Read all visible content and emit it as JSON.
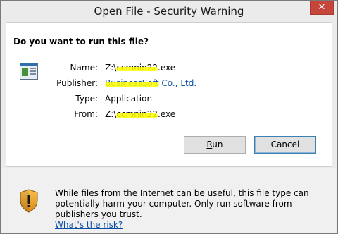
{
  "window": {
    "title": "Open File - Security Warning",
    "close_glyph": "✕"
  },
  "question": "Do you want to run this file?",
  "file_icon": "application-window-icon",
  "details": {
    "name_label": "Name:",
    "name_value_prefix": "Z:\\",
    "name_value_hidden": "ccmnin22",
    "name_value_suffix": ".exe",
    "publisher_label": "Publisher:",
    "publisher_value_hidden": "BusinessSoft",
    "publisher_value_suffix": "Co., Ltd.",
    "type_label": "Type:",
    "type_value": "Application",
    "from_label": "From:",
    "from_value_prefix": "Z:\\",
    "from_value_hidden": "ccmnin22",
    "from_value_suffix": ".exe"
  },
  "buttons": {
    "run": "Run",
    "run_accel": "R",
    "run_rest": "un",
    "cancel": "Cancel"
  },
  "warning": {
    "text": "While files from the Internet can be useful, this file type can potentially harm your computer. Only run software from publishers you trust.",
    "link": "What's the risk?",
    "icon": "shield-warning-icon"
  }
}
